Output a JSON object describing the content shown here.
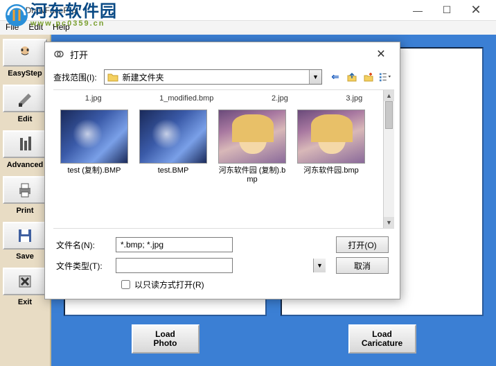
{
  "app": {
    "title": "uDrawFacePro",
    "menu": {
      "file": "File",
      "edit": "Edit",
      "help": "Help"
    },
    "winbtns": {
      "min": "—",
      "max": "☐",
      "close": "✕"
    }
  },
  "watermark": {
    "main": "河东软件园",
    "sub": "www.pc0359.cn"
  },
  "sidebar": {
    "items": [
      {
        "label": "EasyStep"
      },
      {
        "label": "Edit"
      },
      {
        "label": "Advanced"
      },
      {
        "label": "Print"
      },
      {
        "label": "Save"
      },
      {
        "label": "Exit"
      }
    ]
  },
  "canvas": {
    "loadPhoto": "Load\nPhoto",
    "loadCaricature": "Load\nCaricature"
  },
  "dialog": {
    "title": "打开",
    "lookIn": "查找范围(I):",
    "folder": "新建文件夹",
    "navIcons": {
      "back": "⇐",
      "up": "📁",
      "newfolder": "✳",
      "views": "☰▾"
    },
    "topRow": [
      "1.jpg",
      "1_modified.bmp",
      "2.jpg",
      "3.jpg"
    ],
    "files": [
      {
        "name": "test (复制).BMP",
        "thumbClass": "anime1"
      },
      {
        "name": "test.BMP",
        "thumbClass": "anime1"
      },
      {
        "name": "河东软件园 (复制).bmp",
        "thumbClass": "anime2"
      },
      {
        "name": "河东软件园.bmp",
        "thumbClass": "anime2"
      }
    ],
    "filenameLabel": "文件名(N):",
    "filenameValue": "*.bmp; *.jpg",
    "filetypeLabel": "文件类型(T):",
    "filetypeValue": "",
    "openBtn": "打开(O)",
    "cancelBtn": "取消",
    "readonly": "以只读方式打开(R)"
  }
}
